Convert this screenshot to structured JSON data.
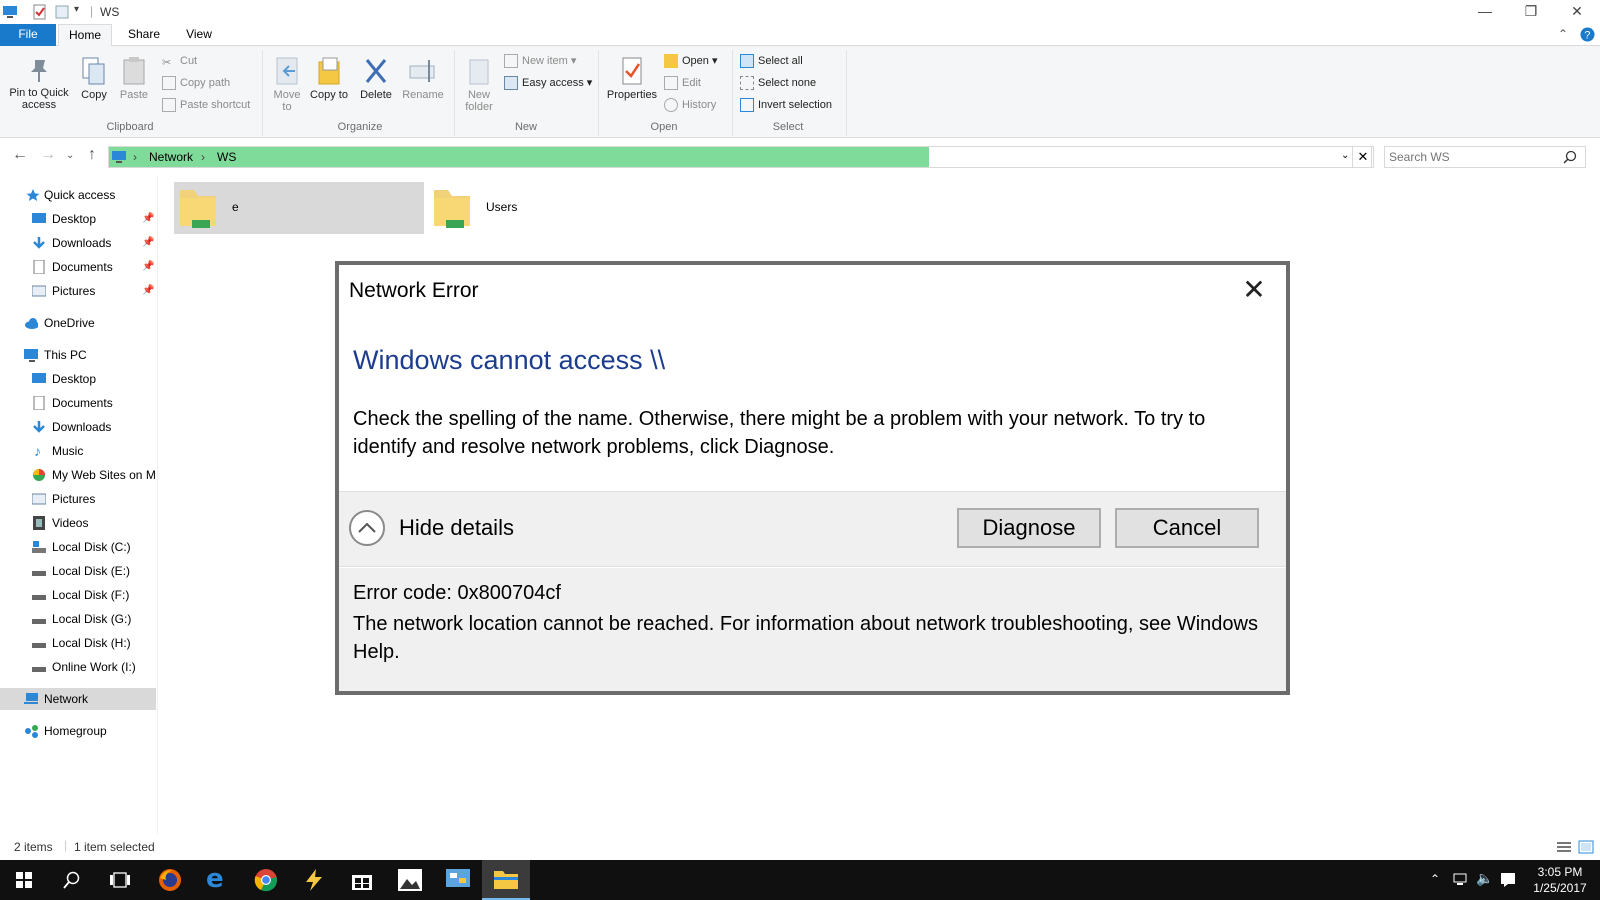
{
  "window": {
    "title": "WS",
    "minimize_glyph": "—",
    "restore_glyph": "❐",
    "close_glyph": "✕"
  },
  "ribbon_tabs": [
    "File",
    "Home",
    "Share",
    "View"
  ],
  "ribbon": {
    "clipboard": {
      "label": "Clipboard",
      "pin_label": "Pin to Quick access",
      "copy_label": "Copy",
      "paste_label": "Paste",
      "cut_label": "Cut",
      "copy_path_label": "Copy path",
      "paste_shortcut_label": "Paste shortcut"
    },
    "organize": {
      "label": "Organize",
      "move_to_label": "Move to",
      "copy_to_label": "Copy to",
      "delete_label": "Delete",
      "rename_label": "Rename"
    },
    "new": {
      "label": "New",
      "new_folder_label": "New folder",
      "new_item_label": "New item",
      "easy_access_label": "Easy access"
    },
    "open": {
      "label": "Open",
      "properties_label": "Properties",
      "open_label": "Open",
      "edit_label": "Edit",
      "history_label": "History"
    },
    "select": {
      "label": "Select",
      "select_all_label": "Select all",
      "select_none_label": "Select none",
      "invert_selection_label": "Invert selection"
    }
  },
  "address": {
    "crumbs": [
      "Network",
      "WS"
    ],
    "search_placeholder": "Search WS",
    "progress": 0.65
  },
  "nav_pane": {
    "quick_access": "Quick access",
    "quick_items": [
      "Desktop",
      "Downloads",
      "Documents",
      "Pictures"
    ],
    "onedrive": "OneDrive",
    "this_pc": "This PC",
    "pc_items": [
      "Desktop",
      "Documents",
      "Downloads",
      "Music",
      "My Web Sites on M",
      "Pictures",
      "Videos",
      "Local Disk (C:)",
      "Local Disk (E:)",
      "Local Disk (F:)",
      "Local Disk (G:)",
      "Local Disk (H:)",
      "Online Work (I:)"
    ],
    "network": "Network",
    "homegroup": "Homegroup"
  },
  "content": {
    "items": [
      "e",
      "Users"
    ]
  },
  "status": {
    "count": "2 items",
    "selected": "1 item selected"
  },
  "dialog": {
    "title": "Network Error",
    "heading": "Windows cannot access \\\\",
    "message": "Check the spelling of the name. Otherwise, there might be a problem with your network. To try to identify and resolve network problems, click Diagnose.",
    "hide_details": "Hide details",
    "diagnose": "Diagnose",
    "cancel": "Cancel",
    "error_code": "Error code: 0x800704cf",
    "error_text": "The network location cannot be reached. For information about network troubleshooting, see Windows Help."
  },
  "taskbar": {
    "time": "3:05 PM",
    "date": "1/25/2017"
  },
  "colors": {
    "accent": "#1979ca",
    "address_progress": "#7fdb9a",
    "dialog_heading": "#1c3c8f"
  }
}
